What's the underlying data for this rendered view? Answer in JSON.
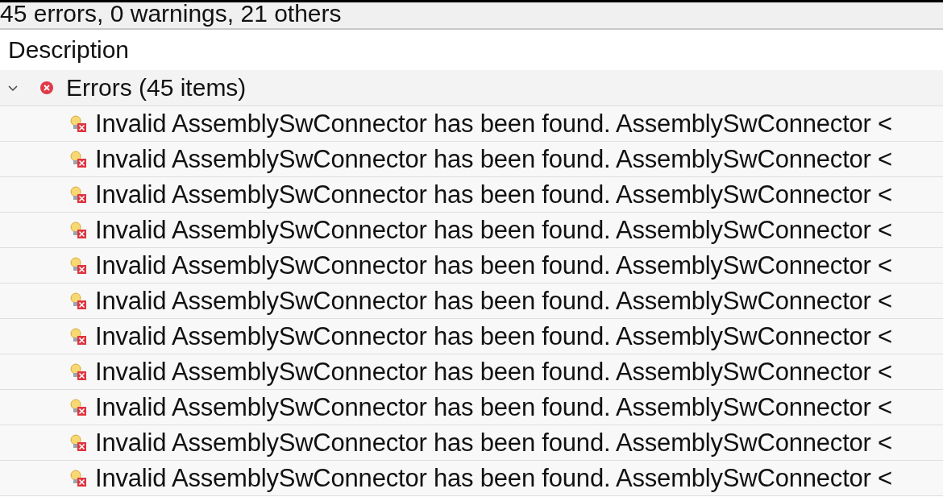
{
  "status_line": "45 errors, 0 warnings, 21 others",
  "columns": [
    "Description"
  ],
  "groups": [
    {
      "label": "Errors (45 items)",
      "expanded": true,
      "items": [
        "Invalid AssemblySwConnector has been found. AssemblySwConnector <",
        "Invalid AssemblySwConnector has been found. AssemblySwConnector <",
        "Invalid AssemblySwConnector has been found. AssemblySwConnector <",
        "Invalid AssemblySwConnector has been found. AssemblySwConnector <",
        "Invalid AssemblySwConnector has been found. AssemblySwConnector <",
        "Invalid AssemblySwConnector has been found. AssemblySwConnector <",
        "Invalid AssemblySwConnector has been found. AssemblySwConnector <",
        "Invalid AssemblySwConnector has been found. AssemblySwConnector <",
        "Invalid AssemblySwConnector has been found. AssemblySwConnector <",
        "Invalid AssemblySwConnector has been found. AssemblySwConnector <",
        "Invalid AssemblySwConnector has been found. AssemblySwConnector <"
      ]
    }
  ]
}
